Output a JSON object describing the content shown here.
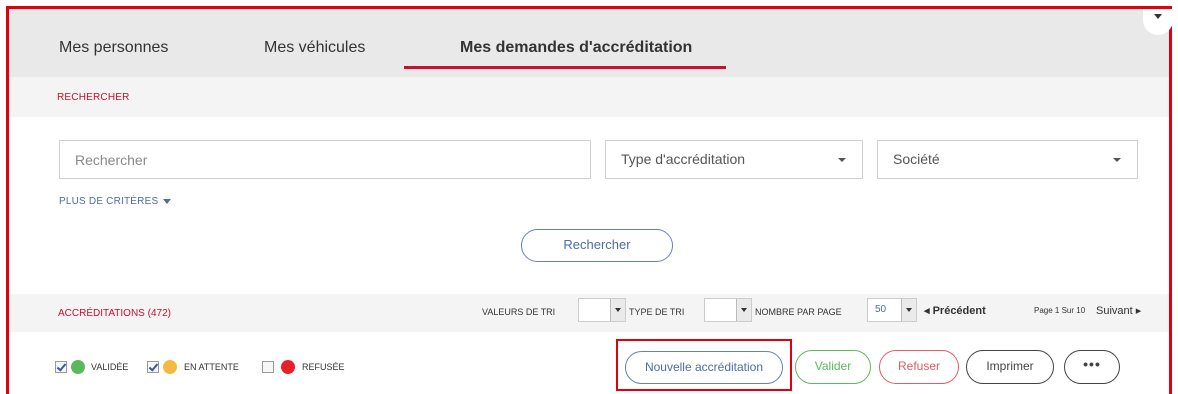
{
  "tabs": [
    {
      "label": "Mes personnes"
    },
    {
      "label": "Mes véhicules"
    },
    {
      "label": "Mes demandes d'accréditation"
    }
  ],
  "search": {
    "header": "RECHERCHER",
    "query_placeholder": "Rechercher",
    "type_select": "Type d'accréditation",
    "company_select": "Société",
    "more_criteria": "PLUS DE CRITÈRES",
    "submit_label": "Rechercher"
  },
  "results": {
    "title": "ACCRÉDITATIONS (472)",
    "sort_values_label": "VALEURS DE TRI",
    "sort_type_label": "TYPE DE TRI",
    "per_page_label": "NOMBRE PAR PAGE",
    "per_page_value": "50",
    "prev_label": "◂ Précédent",
    "page_info": "Page 1 Sur 10",
    "next_label": "Suivant ▸"
  },
  "legend": [
    {
      "label": "VALIDÉE",
      "checked": true,
      "color": "#5cb85c"
    },
    {
      "label": "EN ATTENTE",
      "checked": true,
      "color": "#f5b942"
    },
    {
      "label": "REFUSÉE",
      "checked": false,
      "color": "#e8202a"
    }
  ],
  "actions": {
    "new_label": "Nouvelle accréditation",
    "validate_label": "Valider",
    "refuse_label": "Refuser",
    "print_label": "Imprimer",
    "more_label": "•••"
  },
  "colors": {
    "accent_red": "#c8102e",
    "link_blue": "#4a6da7",
    "highlight_border": "#e0000f"
  }
}
